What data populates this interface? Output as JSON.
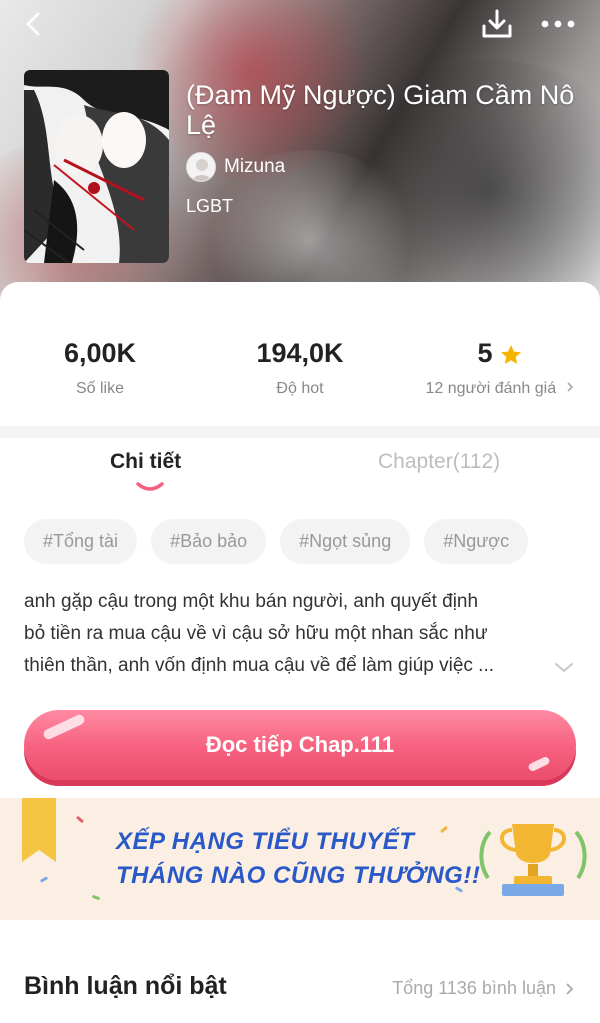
{
  "header": {
    "title": "(Đam Mỹ Ngược) Giam Cầm Nô Lệ",
    "author": "Mizuna",
    "genre": "LGBT"
  },
  "stats": {
    "likes_value": "6,00K",
    "likes_label": "Số like",
    "hot_value": "194,0K",
    "hot_label": "Độ hot",
    "rating_value": "5",
    "rating_label": "12 người đánh giá"
  },
  "tabs": {
    "detail_label": "Chi tiết",
    "chapter_label": "Chapter(112)"
  },
  "tags": [
    "#Tổng tài",
    "#Bảo bảo",
    "#Ngọt sủng",
    "#Ngược"
  ],
  "description": {
    "line1": "anh gặp cậu trong một khu bán người, anh quyết định",
    "line2": "bỏ tiền ra mua cậu về vì cậu sở hữu một nhan sắc như",
    "line3": "thiên thần, anh vốn định mua cậu về để làm giúp việc ..."
  },
  "read_button": {
    "label": "Đọc tiếp Chap.111"
  },
  "banner": {
    "line1": "XẾP HẠNG TIỂU THUYẾT",
    "line2": "THÁNG NÀO CŨNG THƯỞNG!!"
  },
  "comments": {
    "heading": "Bình luận nổi bật",
    "total": "Tổng 1136 bình luận"
  },
  "icons": {
    "back": "chevron-left-icon",
    "download": "download-icon",
    "more": "more-icon",
    "star": "star-icon",
    "expand": "chevron-down-icon",
    "arrow": "chevron-right-icon"
  },
  "colors": {
    "accent": "#f6607e",
    "star": "#f5b400",
    "banner_text": "#2a58c8",
    "banner_bg": "#fbefe3"
  }
}
